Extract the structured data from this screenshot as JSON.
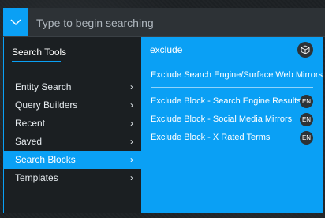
{
  "search": {
    "placeholder": "Type to begin searching",
    "toggle_icon": "chevron-down-icon"
  },
  "sidebar": {
    "heading": "Search Tools",
    "items": [
      {
        "label": "Entity Search",
        "active": false
      },
      {
        "label": "Query Builders",
        "active": false
      },
      {
        "label": "Recent",
        "active": false
      },
      {
        "label": "Saved",
        "active": false
      },
      {
        "label": "Search Blocks",
        "active": true
      },
      {
        "label": "Templates",
        "active": false
      }
    ],
    "chevron": "›"
  },
  "blocks_panel": {
    "filter_value": "exclude",
    "cube_icon": "cube-icon",
    "featured_label": "Exclude Search Engine/Surface Web Mirrors",
    "results": [
      {
        "label": "Exclude Block - Search Engine Results",
        "lang": "EN"
      },
      {
        "label": "Exclude Block - Social Media Mirrors",
        "lang": "EN"
      },
      {
        "label": "Exclude Block - X Rated Terms",
        "lang": "EN"
      }
    ]
  },
  "colors": {
    "accent": "#0aa0f5",
    "dark": "#1b1f22",
    "badge": "#2d3236"
  }
}
